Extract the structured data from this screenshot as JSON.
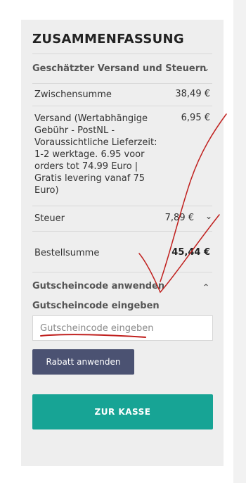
{
  "summary": {
    "title": "ZUSAMMENFASSUNG",
    "shipping_section_label": "Geschätzter Versand und Steuern",
    "rows": [
      {
        "label": "Zwischensumme",
        "value": "38,49 €"
      },
      {
        "label_lines": [
          "Versand (Wertabhängige",
          "Gebühr - PostNL -",
          "Voraussichtliche Lieferzeit:",
          "1-2 werktage. 6.95 voor",
          "orders tot 74.99 Euro |",
          "Gratis levering vanaf 75",
          "Euro)"
        ],
        "value": "6,95 €"
      },
      {
        "label": "Steuer",
        "value": "7,89 €"
      },
      {
        "label": "Bestellsumme",
        "value": "45,44 €"
      }
    ]
  },
  "coupon": {
    "section_label": "Gutscheincode anwenden",
    "field_label": "Gutscheincode eingeben",
    "input_placeholder": "Gutscheincode eingeben",
    "input_value": "",
    "apply_button_label": "Rabatt anwenden"
  },
  "checkout": {
    "button_label": "ZUR KASSE"
  },
  "colors": {
    "panel_bg": "#eeeeee",
    "discount_button": "#4b5272",
    "checkout_button": "#17a495",
    "annotation_ink": "#c0201e"
  },
  "icons": {
    "shipping_toggle": "chevron-down-icon",
    "tax_toggle": "chevron-down-icon",
    "coupon_toggle": "chevron-up-icon"
  }
}
